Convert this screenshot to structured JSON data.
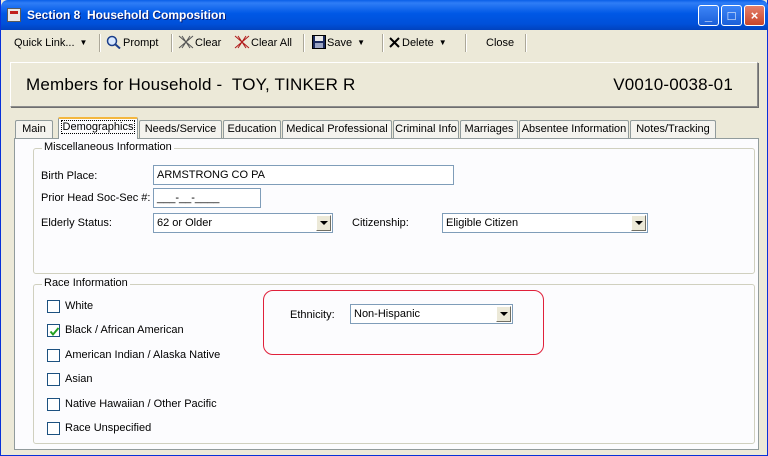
{
  "window": {
    "title": "Section 8  Household Composition",
    "controls": {
      "minimize": "_",
      "maximize": "□",
      "close": "×"
    }
  },
  "toolbar": {
    "quick_link": "Quick Link...",
    "prompt": "Prompt",
    "clear": "Clear",
    "clear_all": "Clear All",
    "save": "Save",
    "delete": "Delete",
    "close": "Close",
    "icons": {
      "prompt": "magnifier-icon",
      "clear": "eraser-icon",
      "clear_all": "eraser-all-icon",
      "save": "floppy-disk-icon",
      "delete": "x-delete-icon"
    }
  },
  "header": {
    "title": "Members for Household -  TOY, TINKER R",
    "code": "V0010-0038-01"
  },
  "tabs": [
    {
      "label": "Main",
      "active": false
    },
    {
      "label": "Demographics",
      "active": true
    },
    {
      "label": "Needs/Service",
      "active": false
    },
    {
      "label": "Education",
      "active": false
    },
    {
      "label": "Medical Professional",
      "active": false
    },
    {
      "label": "Criminal Info",
      "active": false
    },
    {
      "label": "Marriages",
      "active": false
    },
    {
      "label": "Absentee Information",
      "active": false
    },
    {
      "label": "Notes/Tracking",
      "active": false
    }
  ],
  "misc": {
    "group_label": "Miscellaneous Information",
    "birth_place_label": "Birth Place:",
    "birth_place_value": "ARMSTRONG CO PA",
    "prior_head_label": "Prior Head Soc-Sec #:",
    "prior_head_value": "___-__-____",
    "elderly_label": "Elderly Status:",
    "elderly_value": "62 or Older",
    "citizenship_label": "Citizenship:",
    "citizenship_value": "Eligible Citizen"
  },
  "race": {
    "group_label": "Race Information",
    "options": [
      {
        "label": "White",
        "checked": false
      },
      {
        "label": "Black / African American",
        "checked": true
      },
      {
        "label": "American Indian / Alaska Native",
        "checked": false
      },
      {
        "label": "Asian",
        "checked": false
      },
      {
        "label": "Native Hawaiian / Other Pacific",
        "checked": false
      },
      {
        "label": "Race Unspecified",
        "checked": false
      }
    ],
    "ethnicity_label": "Ethnicity:",
    "ethnicity_value": "Non-Hispanic"
  },
  "colors": {
    "titlebar": "#0058e6",
    "highlight": "#e0203a",
    "tab_active_accent": "#f4b73f"
  }
}
